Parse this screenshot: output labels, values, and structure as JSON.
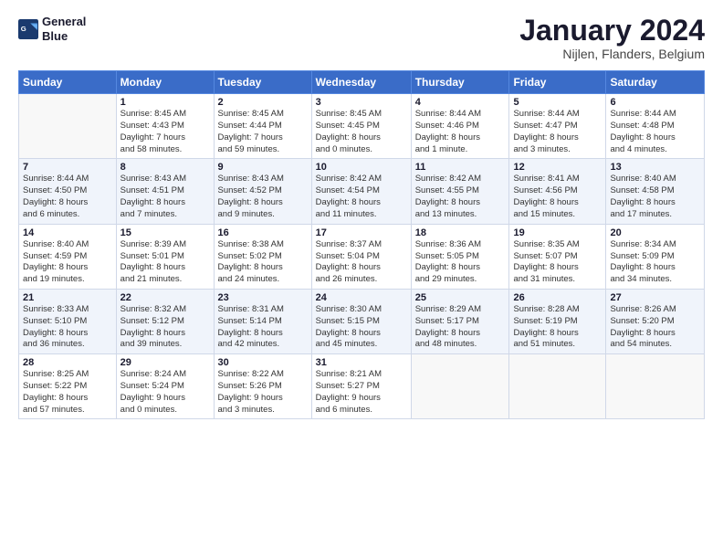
{
  "logo": {
    "line1": "General",
    "line2": "Blue"
  },
  "title": "January 2024",
  "subtitle": "Nijlen, Flanders, Belgium",
  "calendar": {
    "headers": [
      "Sunday",
      "Monday",
      "Tuesday",
      "Wednesday",
      "Thursday",
      "Friday",
      "Saturday"
    ],
    "weeks": [
      [
        {
          "day": "",
          "info": ""
        },
        {
          "day": "1",
          "info": "Sunrise: 8:45 AM\nSunset: 4:43 PM\nDaylight: 7 hours\nand 58 minutes."
        },
        {
          "day": "2",
          "info": "Sunrise: 8:45 AM\nSunset: 4:44 PM\nDaylight: 7 hours\nand 59 minutes."
        },
        {
          "day": "3",
          "info": "Sunrise: 8:45 AM\nSunset: 4:45 PM\nDaylight: 8 hours\nand 0 minutes."
        },
        {
          "day": "4",
          "info": "Sunrise: 8:44 AM\nSunset: 4:46 PM\nDaylight: 8 hours\nand 1 minute."
        },
        {
          "day": "5",
          "info": "Sunrise: 8:44 AM\nSunset: 4:47 PM\nDaylight: 8 hours\nand 3 minutes."
        },
        {
          "day": "6",
          "info": "Sunrise: 8:44 AM\nSunset: 4:48 PM\nDaylight: 8 hours\nand 4 minutes."
        }
      ],
      [
        {
          "day": "7",
          "info": "Sunrise: 8:44 AM\nSunset: 4:50 PM\nDaylight: 8 hours\nand 6 minutes."
        },
        {
          "day": "8",
          "info": "Sunrise: 8:43 AM\nSunset: 4:51 PM\nDaylight: 8 hours\nand 7 minutes."
        },
        {
          "day": "9",
          "info": "Sunrise: 8:43 AM\nSunset: 4:52 PM\nDaylight: 8 hours\nand 9 minutes."
        },
        {
          "day": "10",
          "info": "Sunrise: 8:42 AM\nSunset: 4:54 PM\nDaylight: 8 hours\nand 11 minutes."
        },
        {
          "day": "11",
          "info": "Sunrise: 8:42 AM\nSunset: 4:55 PM\nDaylight: 8 hours\nand 13 minutes."
        },
        {
          "day": "12",
          "info": "Sunrise: 8:41 AM\nSunset: 4:56 PM\nDaylight: 8 hours\nand 15 minutes."
        },
        {
          "day": "13",
          "info": "Sunrise: 8:40 AM\nSunset: 4:58 PM\nDaylight: 8 hours\nand 17 minutes."
        }
      ],
      [
        {
          "day": "14",
          "info": "Sunrise: 8:40 AM\nSunset: 4:59 PM\nDaylight: 8 hours\nand 19 minutes."
        },
        {
          "day": "15",
          "info": "Sunrise: 8:39 AM\nSunset: 5:01 PM\nDaylight: 8 hours\nand 21 minutes."
        },
        {
          "day": "16",
          "info": "Sunrise: 8:38 AM\nSunset: 5:02 PM\nDaylight: 8 hours\nand 24 minutes."
        },
        {
          "day": "17",
          "info": "Sunrise: 8:37 AM\nSunset: 5:04 PM\nDaylight: 8 hours\nand 26 minutes."
        },
        {
          "day": "18",
          "info": "Sunrise: 8:36 AM\nSunset: 5:05 PM\nDaylight: 8 hours\nand 29 minutes."
        },
        {
          "day": "19",
          "info": "Sunrise: 8:35 AM\nSunset: 5:07 PM\nDaylight: 8 hours\nand 31 minutes."
        },
        {
          "day": "20",
          "info": "Sunrise: 8:34 AM\nSunset: 5:09 PM\nDaylight: 8 hours\nand 34 minutes."
        }
      ],
      [
        {
          "day": "21",
          "info": "Sunrise: 8:33 AM\nSunset: 5:10 PM\nDaylight: 8 hours\nand 36 minutes."
        },
        {
          "day": "22",
          "info": "Sunrise: 8:32 AM\nSunset: 5:12 PM\nDaylight: 8 hours\nand 39 minutes."
        },
        {
          "day": "23",
          "info": "Sunrise: 8:31 AM\nSunset: 5:14 PM\nDaylight: 8 hours\nand 42 minutes."
        },
        {
          "day": "24",
          "info": "Sunrise: 8:30 AM\nSunset: 5:15 PM\nDaylight: 8 hours\nand 45 minutes."
        },
        {
          "day": "25",
          "info": "Sunrise: 8:29 AM\nSunset: 5:17 PM\nDaylight: 8 hours\nand 48 minutes."
        },
        {
          "day": "26",
          "info": "Sunrise: 8:28 AM\nSunset: 5:19 PM\nDaylight: 8 hours\nand 51 minutes."
        },
        {
          "day": "27",
          "info": "Sunrise: 8:26 AM\nSunset: 5:20 PM\nDaylight: 8 hours\nand 54 minutes."
        }
      ],
      [
        {
          "day": "28",
          "info": "Sunrise: 8:25 AM\nSunset: 5:22 PM\nDaylight: 8 hours\nand 57 minutes."
        },
        {
          "day": "29",
          "info": "Sunrise: 8:24 AM\nSunset: 5:24 PM\nDaylight: 9 hours\nand 0 minutes."
        },
        {
          "day": "30",
          "info": "Sunrise: 8:22 AM\nSunset: 5:26 PM\nDaylight: 9 hours\nand 3 minutes."
        },
        {
          "day": "31",
          "info": "Sunrise: 8:21 AM\nSunset: 5:27 PM\nDaylight: 9 hours\nand 6 minutes."
        },
        {
          "day": "",
          "info": ""
        },
        {
          "day": "",
          "info": ""
        },
        {
          "day": "",
          "info": ""
        }
      ]
    ]
  }
}
